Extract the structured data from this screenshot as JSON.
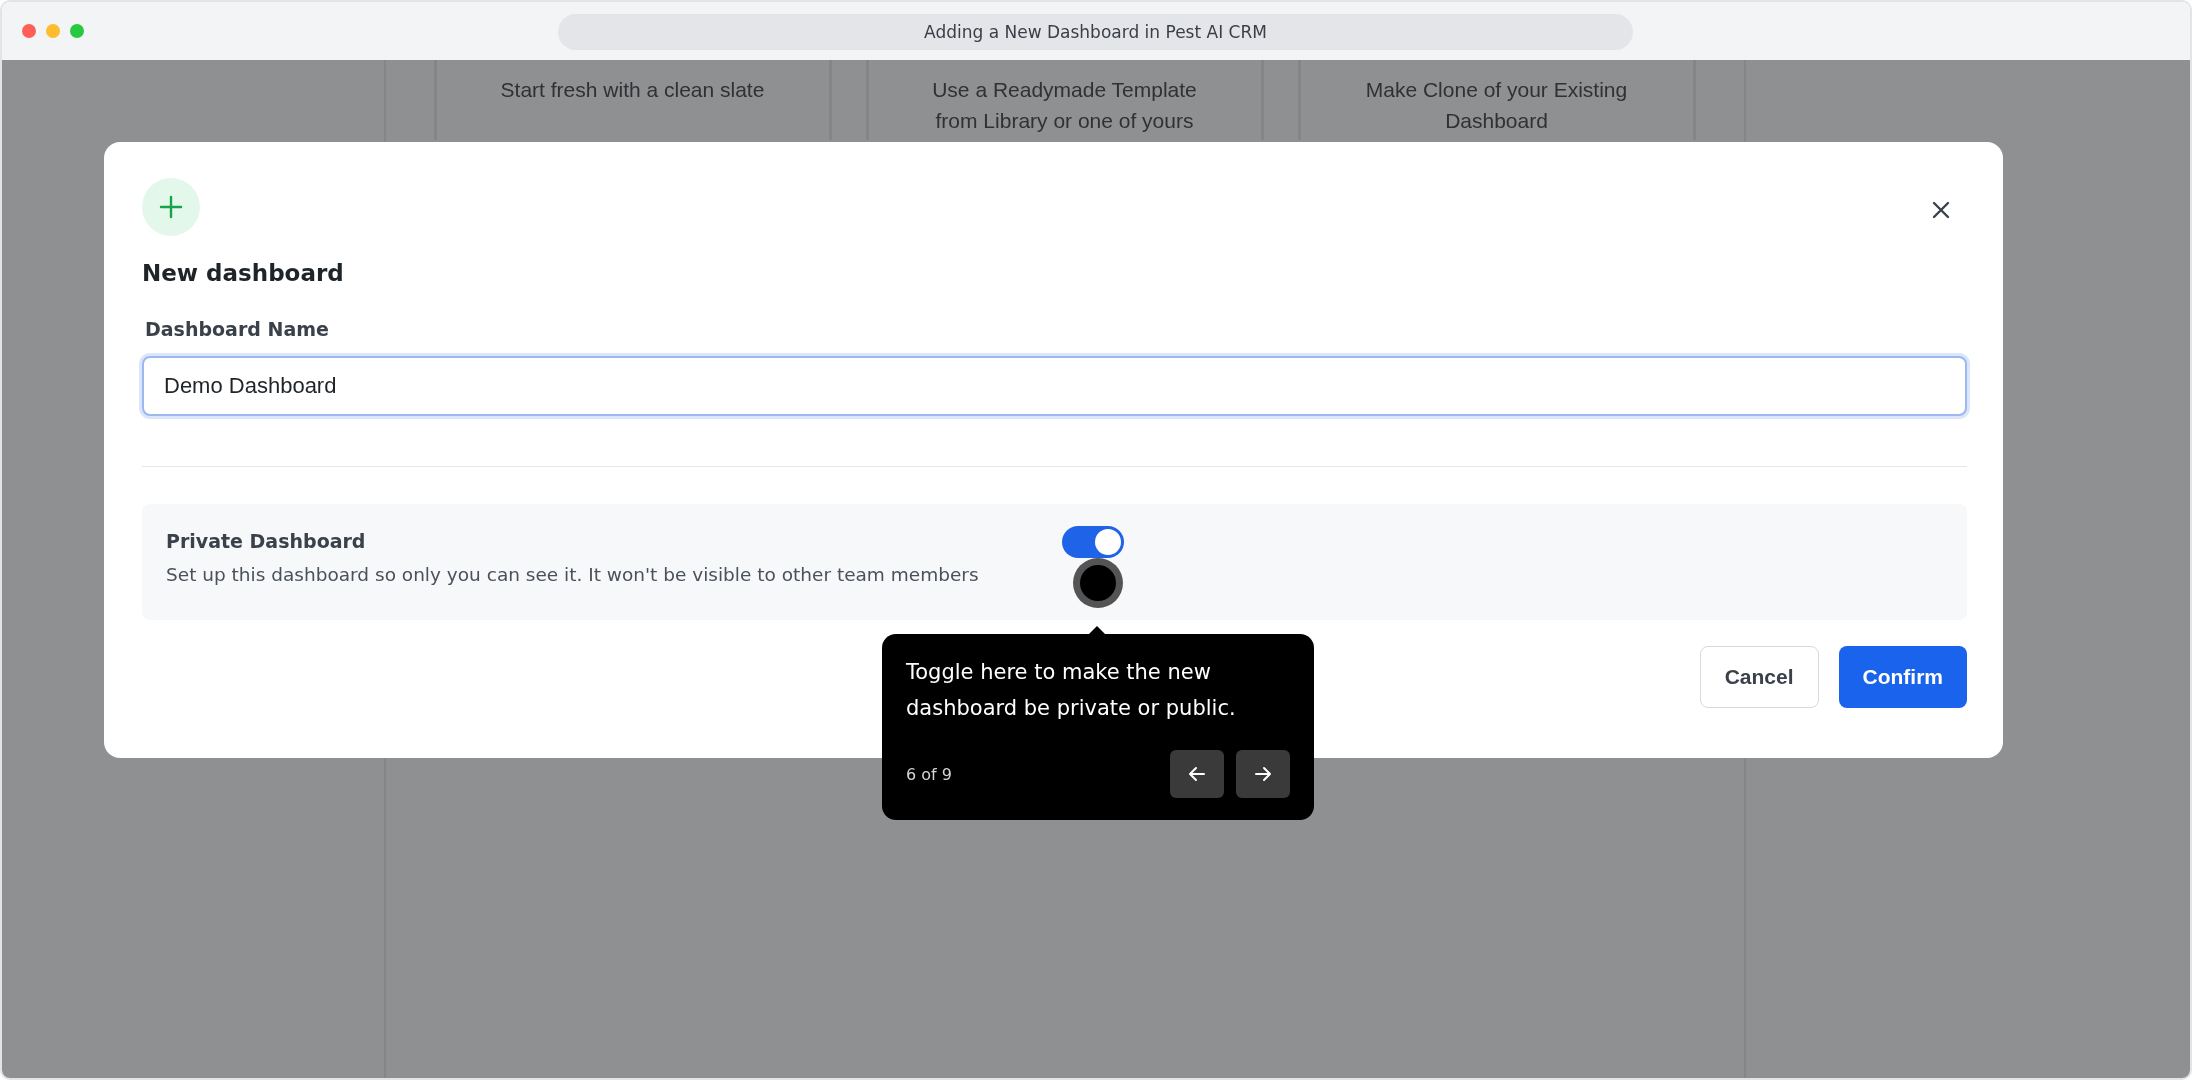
{
  "window": {
    "title": "Adding a New Dashboard in Pest AI CRM"
  },
  "background_cards": [
    {
      "text": "Start fresh with a clean slate"
    },
    {
      "text": "Use a Readymade Template from Library or one of yours"
    },
    {
      "text": "Make Clone of your Existing Dashboard"
    }
  ],
  "dialog": {
    "title": "New dashboard",
    "field": {
      "label": "Dashboard Name",
      "value": "Demo Dashboard"
    },
    "private": {
      "title": "Private Dashboard",
      "description": "Set up this dashboard so only you can see it. It won't be visible to other team members",
      "on": true
    },
    "buttons": [
      {
        "label": "Cancel",
        "kind": "secondary"
      },
      {
        "label": "Confirm",
        "kind": "primary"
      }
    ]
  },
  "tooltip": {
    "text": "Toggle here to make the new dashboard be private or public.",
    "step": "6 of 9"
  }
}
